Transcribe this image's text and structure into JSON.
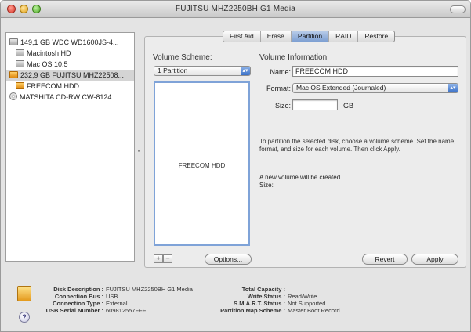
{
  "window": {
    "title": "FUJITSU MHZ2250BH G1 Media"
  },
  "sidebar": {
    "items": [
      {
        "label": "149,1 GB WDC WD1600JS-4...",
        "icon": "hard-disk-icon"
      },
      {
        "label": "Macintosh HD",
        "icon": "volume-icon"
      },
      {
        "label": "Mac OS 10.5",
        "icon": "volume-icon"
      },
      {
        "label": "232,9 GB FUJITSU MHZ22508...",
        "icon": "external-disk-icon"
      },
      {
        "label": "FREECOM HDD",
        "icon": "external-volume-icon"
      },
      {
        "label": "MATSHITA CD-RW CW-8124",
        "icon": "optical-drive-icon"
      }
    ]
  },
  "tabs": [
    "First Aid",
    "Erase",
    "Partition",
    "RAID",
    "Restore"
  ],
  "active_tab": "Partition",
  "partition": {
    "volume_scheme_label": "Volume Scheme:",
    "volume_scheme_value": "1 Partition",
    "volume_info_label": "Volume Information",
    "name_label": "Name:",
    "name_value": "FREECOM HDD",
    "format_label": "Format:",
    "format_value": "Mac OS Extended (Journaled)",
    "size_label": "Size:",
    "size_value": "",
    "size_unit": "GB",
    "volume_box_label": "FREECOM HDD",
    "help_text": "To partition the selected disk, choose a volume scheme. Set the name, format, and size for each volume. Then click Apply.",
    "new_volume_text": "A new volume will be created.",
    "size_info_label": "Size:",
    "add_label": "+",
    "remove_label": "−",
    "options_label": "Options...",
    "revert_label": "Revert",
    "apply_label": "Apply"
  },
  "info": {
    "disk_description_label": "Disk Description :",
    "disk_description_value": "FUJITSU MHZ2250BH G1 Media",
    "connection_bus_label": "Connection Bus :",
    "connection_bus_value": "USB",
    "connection_type_label": "Connection Type :",
    "connection_type_value": "External",
    "usb_serial_label": "USB Serial Number :",
    "usb_serial_value": "609812557FFF",
    "total_capacity_label": "Total Capacity :",
    "total_capacity_value": "",
    "write_status_label": "Write Status :",
    "write_status_value": "Read/Write",
    "smart_status_label": "S.M.A.R.T. Status :",
    "smart_status_value": "Not Supported",
    "partition_map_label": "Partition Map Scheme :",
    "partition_map_value": "Master Boot Record"
  },
  "help_glyph": "?"
}
